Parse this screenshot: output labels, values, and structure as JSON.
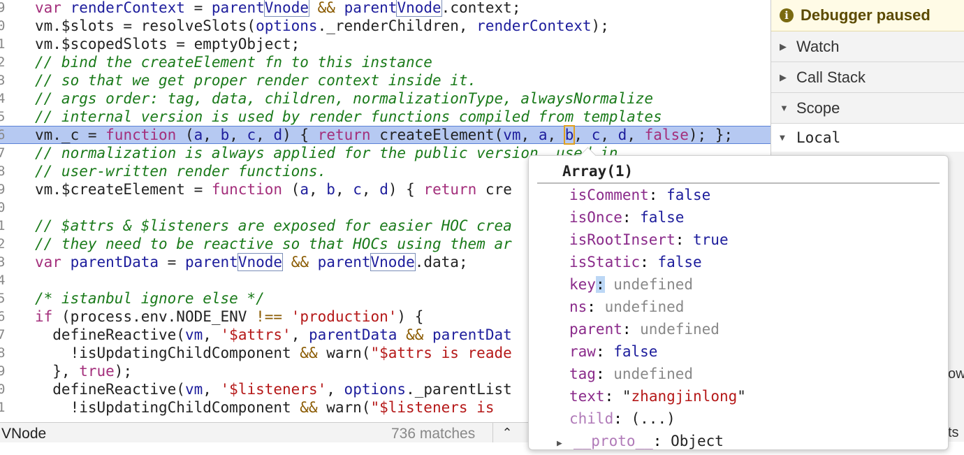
{
  "code_lines": [
    {
      "n": "9",
      "text": "var renderContext = parentVnode && parentVnode.context;"
    },
    {
      "n": "0",
      "text": "vm.$slots = resolveSlots(options._renderChildren, renderContext);"
    },
    {
      "n": "1",
      "text": "vm.$scopedSlots = emptyObject;"
    },
    {
      "n": "2",
      "text": "// bind the createElement fn to this instance"
    },
    {
      "n": "3",
      "text": "// so that we get proper render context inside it."
    },
    {
      "n": "4",
      "text": "// args order: tag, data, children, normalizationType, alwaysNormalize"
    },
    {
      "n": "5",
      "text": "// internal version is used by render functions compiled from templates"
    },
    {
      "n": "6",
      "text": "vm._c = function (a, b, c, d) { return createElement(vm, a, b, c, d, false); };"
    },
    {
      "n": "7",
      "text": "// normalization is always applied for the public version, used in"
    },
    {
      "n": "8",
      "text": "// user-written render functions."
    },
    {
      "n": "9",
      "text": "vm.$createElement = function (a, b, c, d) { return cre"
    },
    {
      "n": "0",
      "text": ""
    },
    {
      "n": "1",
      "text": "// $attrs & $listeners are exposed for easier HOC crea"
    },
    {
      "n": "2",
      "text": "// they need to be reactive so that HOCs using them ar"
    },
    {
      "n": "3",
      "text": "var parentData = parentVnode && parentVnode.data;"
    },
    {
      "n": "4",
      "text": ""
    },
    {
      "n": "5",
      "text": "/* istanbul ignore else */"
    },
    {
      "n": "6",
      "text": "if (process.env.NODE_ENV !== 'production') {"
    },
    {
      "n": "7",
      "text": "  defineReactive(vm, '$attrs', parentData && parentDat"
    },
    {
      "n": "8",
      "text": "    !isUpdatingChildComponent && warn(\"$attrs is reade"
    },
    {
      "n": "9",
      "text": "  }, true);"
    },
    {
      "n": "0",
      "text": "  defineReactive(vm, '$listeners', options._parentList"
    },
    {
      "n": "1",
      "text": "    !isUpdatingChildComponent && warn(\"$listeners is"
    }
  ],
  "sidebar": {
    "paused_label": "Debugger paused",
    "watch": "Watch",
    "call_stack": "Call Stack",
    "scope": "Scope",
    "local": "Local"
  },
  "search": {
    "query": "VNode",
    "matches": "736 matches"
  },
  "popup": {
    "title": "Array(1)",
    "props": [
      {
        "key": "isComment",
        "value": "false",
        "type": "kw"
      },
      {
        "key": "isOnce",
        "value": "false",
        "type": "kw"
      },
      {
        "key": "isRootInsert",
        "value": "true",
        "type": "kw"
      },
      {
        "key": "isStatic",
        "value": "false",
        "type": "kw"
      },
      {
        "key": "key",
        "value": "undefined",
        "type": "u"
      },
      {
        "key": "ns",
        "value": "undefined",
        "type": "u"
      },
      {
        "key": "parent",
        "value": "undefined",
        "type": "u"
      },
      {
        "key": "raw",
        "value": "false",
        "type": "kw"
      },
      {
        "key": "tag",
        "value": "undefined",
        "type": "u"
      },
      {
        "key": "text",
        "value": "zhangjinlong",
        "type": "s"
      },
      {
        "key": "child",
        "value": "(...)",
        "type": "q"
      },
      {
        "key": "__proto__",
        "value": "Object",
        "type": "q"
      }
    ]
  },
  "edge_text": {
    "ow": "ow",
    "ts": "ts"
  },
  "colors": {
    "highlight": "#b6c9f2",
    "paused_bg": "#fffbe6"
  }
}
